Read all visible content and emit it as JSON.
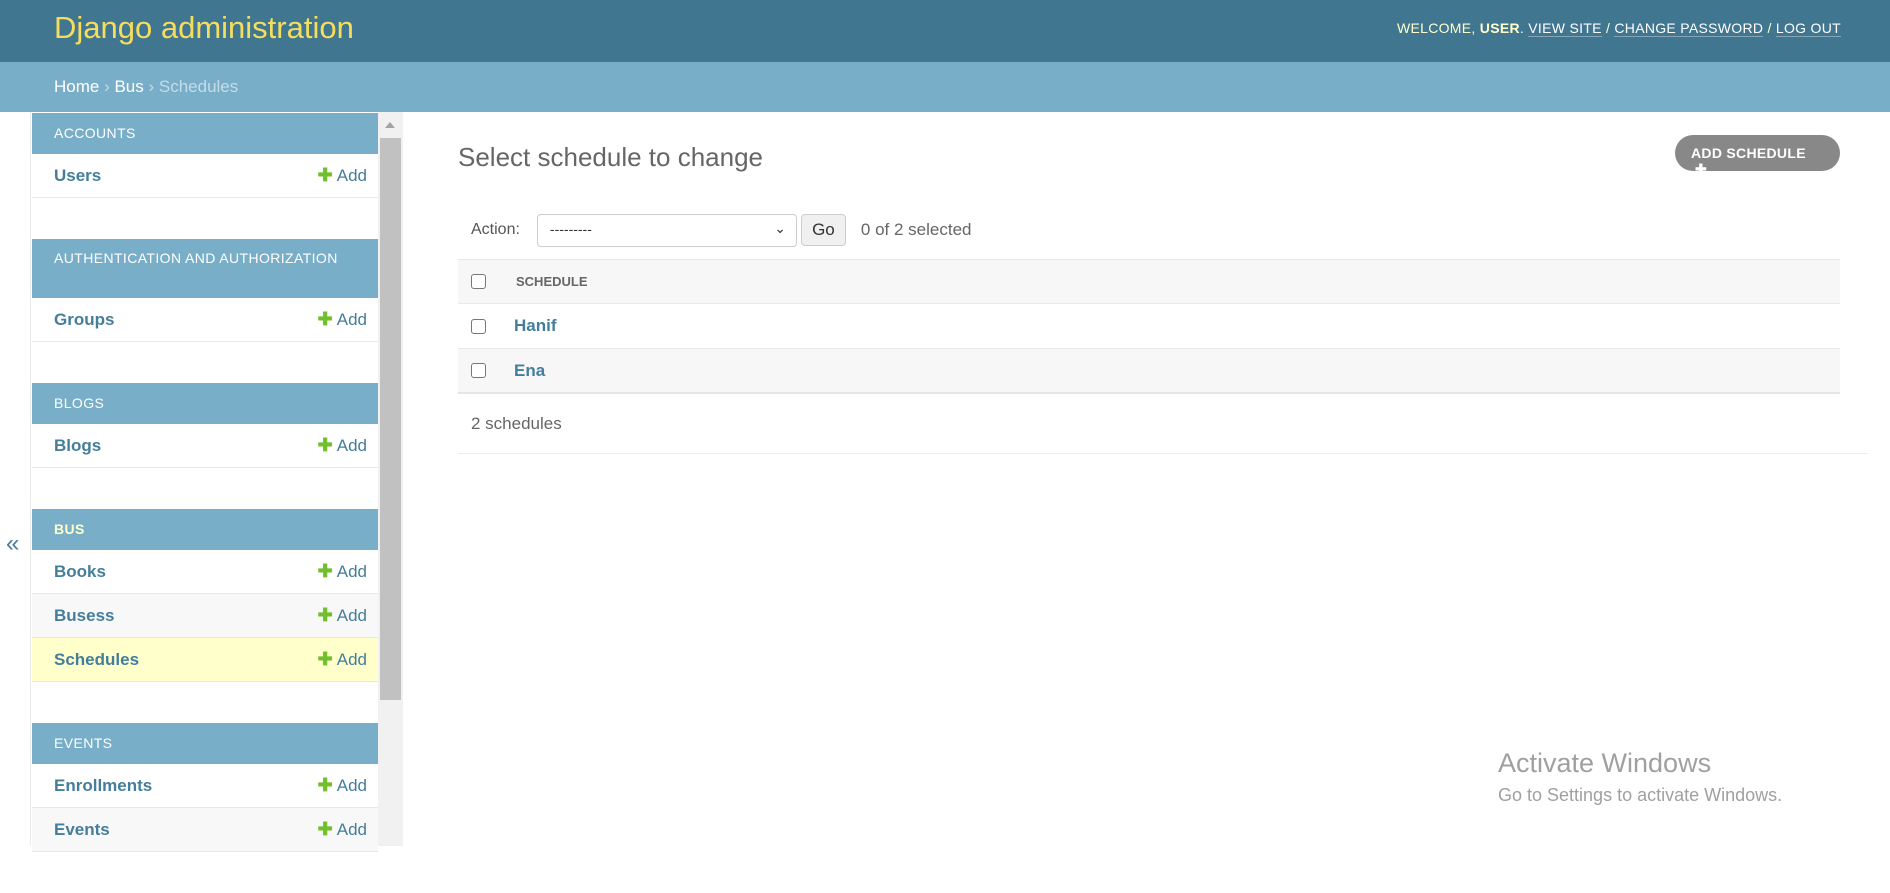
{
  "header": {
    "branding": "Django administration",
    "welcome": "WELCOME, ",
    "user": "USER",
    "links": [
      "VIEW SITE",
      "CHANGE PASSWORD",
      "LOG OUT"
    ],
    "sep": " / "
  },
  "breadcrumbs": {
    "home": "Home",
    "app": "Bus",
    "current": "Schedules"
  },
  "sidebar": {
    "toggle": "«",
    "add_label": "Add",
    "plus": "✚",
    "sections": [
      {
        "caption": "Accounts",
        "models": [
          "Users"
        ]
      },
      {
        "caption": "Authentication and Authorization",
        "models": [
          "Groups"
        ]
      },
      {
        "caption": "Blogs",
        "models": [
          "Blogs"
        ]
      },
      {
        "caption": "Bus",
        "models": [
          "Books",
          "Busess",
          "Schedules"
        ],
        "current": true,
        "selected_model": "Schedules"
      },
      {
        "caption": "Events",
        "models": [
          "Enrollments",
          "Events"
        ]
      }
    ]
  },
  "main": {
    "title": "Select schedule to change",
    "add_button": "ADD SCHEDULE",
    "action_label": "Action:",
    "action_value": "---------",
    "go": "Go",
    "selected_count": "0 of 2 selected",
    "column": "SCHEDULE",
    "rows": [
      "Hanif",
      "Ena"
    ],
    "paginator": "2 schedules"
  },
  "watermark": {
    "line1": "Activate Windows",
    "line2": "Go to Settings to activate Windows."
  },
  "colors": {
    "header": "#417690",
    "breadcrumb": "#79aec8",
    "branding": "#f5dd5d",
    "link": "#447e9b",
    "add_plus": "#70bf2b",
    "selected_row": "#ffffcc"
  }
}
